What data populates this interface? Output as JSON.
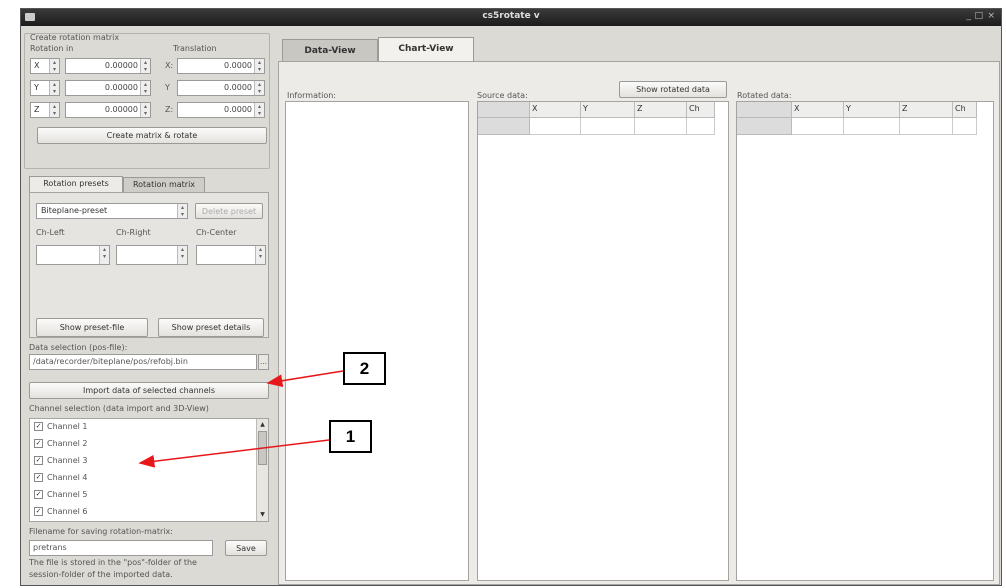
{
  "window": {
    "title": "cs5rotate v"
  },
  "rotation_matrix_group": {
    "title": "Create rotation matrix",
    "rotation_label": "Rotation in",
    "translation_label": "Translation",
    "rows": [
      {
        "axis": "X",
        "rotation": "0.00000",
        "trans_axis": "X:",
        "translation": "0.0000"
      },
      {
        "axis": "Y",
        "rotation": "0.00000",
        "trans_axis": "Y",
        "translation": "0.0000"
      },
      {
        "axis": "Z",
        "rotation": "0.00000",
        "trans_axis": "Z:",
        "translation": "0.0000"
      }
    ],
    "create_button": "Create matrix & rotate"
  },
  "left_tabs": {
    "presets": "Rotation presets",
    "matrix": "Rotation matrix"
  },
  "presets": {
    "selected": "Biteplane-preset",
    "delete_button": "Delete preset",
    "ch_left": "Ch-Left",
    "ch_right": "Ch-Right",
    "ch_center": "Ch-Center",
    "show_file_button": "Show preset-file",
    "show_details_button": "Show preset details"
  },
  "data_selection": {
    "label": "Data selection (pos-file):",
    "path": "/data/recorder/biteplane/pos/refobj.bin",
    "import_button": "Import data of selected channels"
  },
  "channel_selection": {
    "label": "Channel selection (data import and 3D-View)",
    "channels": [
      "Channel 1",
      "Channel 2",
      "Channel 3",
      "Channel 4",
      "Channel 5",
      "Channel 6"
    ]
  },
  "save_section": {
    "label": "Filename for saving rotation-matrix:",
    "filename": "pretrans",
    "save_button": "Save",
    "note_line1": "The file is stored in the \"pos\"-folder of the",
    "note_line2": "session-folder of the imported data."
  },
  "main_tabs": {
    "data_view": "Data-View",
    "chart_view": "Chart-View"
  },
  "data_view": {
    "information_label": "Information:",
    "source_label": "Source data:",
    "show_rotated_button": "Show rotated data",
    "rotated_label": "Rotated data:",
    "columns": [
      "X",
      "Y",
      "Z",
      "Ch"
    ]
  },
  "annotations": {
    "callout_1": "1",
    "callout_2": "2"
  }
}
